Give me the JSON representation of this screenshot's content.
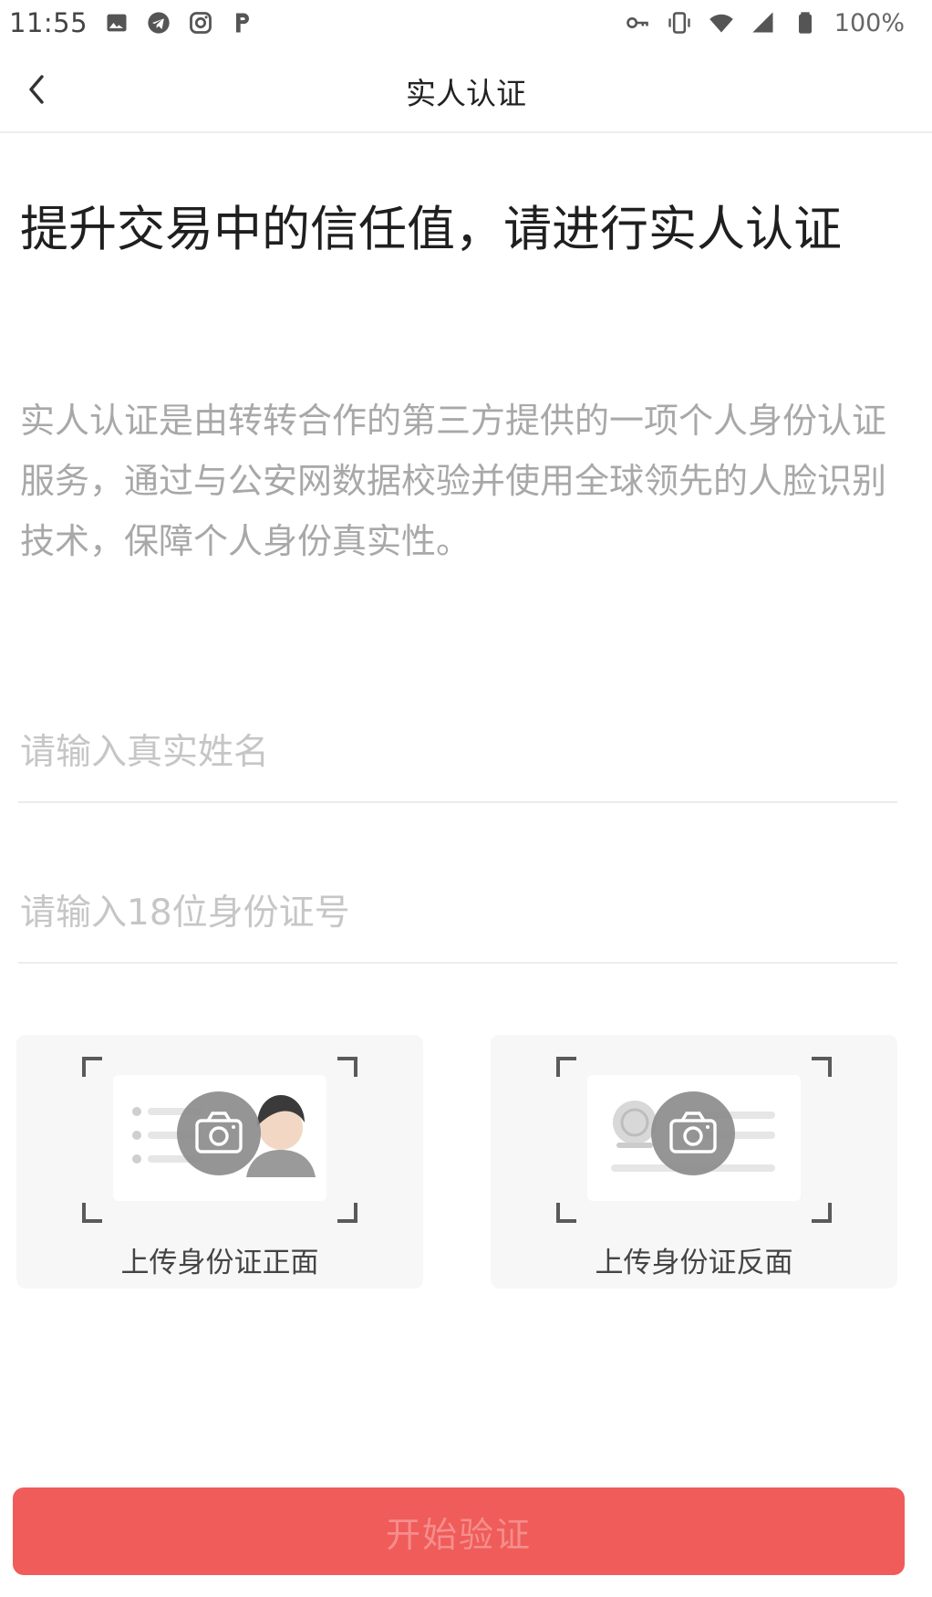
{
  "status_bar": {
    "time": "11:55",
    "left_icons": [
      "image-icon",
      "telegram-icon",
      "instagram-icon",
      "p-app-icon"
    ],
    "right_icons": [
      "key-icon",
      "vibrate-icon",
      "wifi-icon",
      "signal-icon",
      "battery-icon"
    ],
    "battery": "100%"
  },
  "nav": {
    "back_icon": "chevron-left-icon",
    "title": "实人认证"
  },
  "headline": "提升交易中的信任值，请进行实人认证",
  "description": "实人认证是由转转合作的第三方提供的一项个人身份认证服务，通过与公安网数据校验并使用全球领先的人脸识别技术，保障个人身份真实性。",
  "form": {
    "name_placeholder": "请输入真实姓名",
    "name_value": "",
    "id_placeholder": "请输入18位身份证号",
    "id_value": ""
  },
  "uploads": {
    "front_label": "上传身份证正面",
    "back_label": "上传身份证反面",
    "icon": "camera-icon"
  },
  "submit_label": "开始验证",
  "colors": {
    "accent": "#ef5c5a",
    "button_text": "#f58e8c",
    "placeholder": "#c6c6c6",
    "description": "#a8a8a8",
    "card_bg": "#f7f7f7"
  }
}
